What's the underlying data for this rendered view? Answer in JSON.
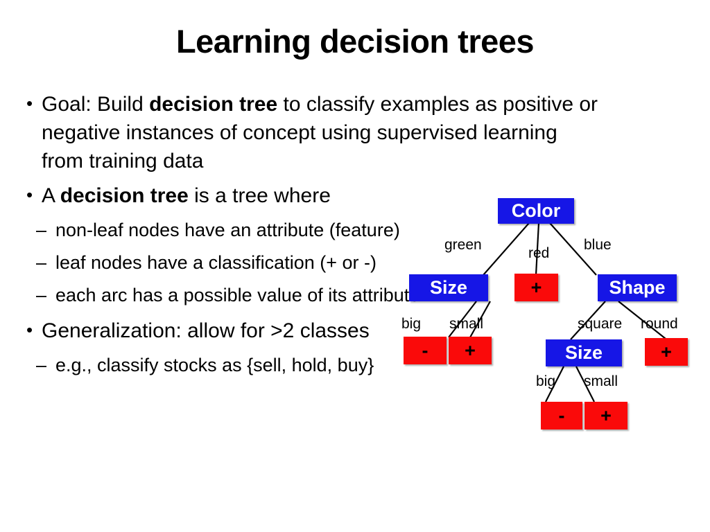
{
  "slide": {
    "title": "Learning decision trees",
    "background_color": "#ffffff",
    "text_color": "#000000"
  },
  "content": {
    "bullet1": {
      "mark": "•",
      "part1": "Goal: Build ",
      "bold1": "decision tree",
      "part2": " to classify examples as positive or negative instances of concept using supervised learning from training data"
    },
    "bullet2": {
      "mark": "•",
      "part1": "A ",
      "bold1": "decision tree",
      "part2": " is a tree where"
    },
    "sub1": {
      "mark": "–",
      "text": " non-leaf nodes have an attribute (feature)"
    },
    "sub2": {
      "mark": "–",
      "text": "leaf nodes have a classification (+ or -)"
    },
    "sub3": {
      "mark": "–",
      "text": "each arc has a possible value of its attribute"
    },
    "bullet3": {
      "mark": "•",
      "text": "Generalization: allow for >2 classes"
    },
    "sub4": {
      "mark": "–",
      "text": "e.g., classify stocks as {sell, hold, buy}"
    }
  },
  "tree": {
    "colors": {
      "attribute_node": "#1616E6",
      "attribute_text": "#ffffff",
      "leaf_node": "#FA0A0A",
      "leaf_text": "#000000",
      "edge": "#000000"
    },
    "nodes": {
      "root": {
        "label": "Color",
        "type": "attribute"
      },
      "size_left": {
        "label": "Size",
        "type": "attribute"
      },
      "plus_red": {
        "label": "+",
        "type": "leaf"
      },
      "shape": {
        "label": "Shape",
        "type": "attribute"
      },
      "minus_big": {
        "label": "-",
        "type": "leaf"
      },
      "plus_small": {
        "label": "+",
        "type": "leaf"
      },
      "size_inner": {
        "label": "Size",
        "type": "attribute"
      },
      "plus_round": {
        "label": "+",
        "type": "leaf"
      },
      "minus_big2": {
        "label": "-",
        "type": "leaf"
      },
      "plus_small2": {
        "label": "+",
        "type": "leaf"
      }
    },
    "edge_labels": {
      "green": "green",
      "red": "red",
      "blue": "blue",
      "big_left": "big",
      "small_left": "small",
      "square": "square",
      "round": "round",
      "big_inner": "big",
      "small_inner": "small"
    }
  }
}
